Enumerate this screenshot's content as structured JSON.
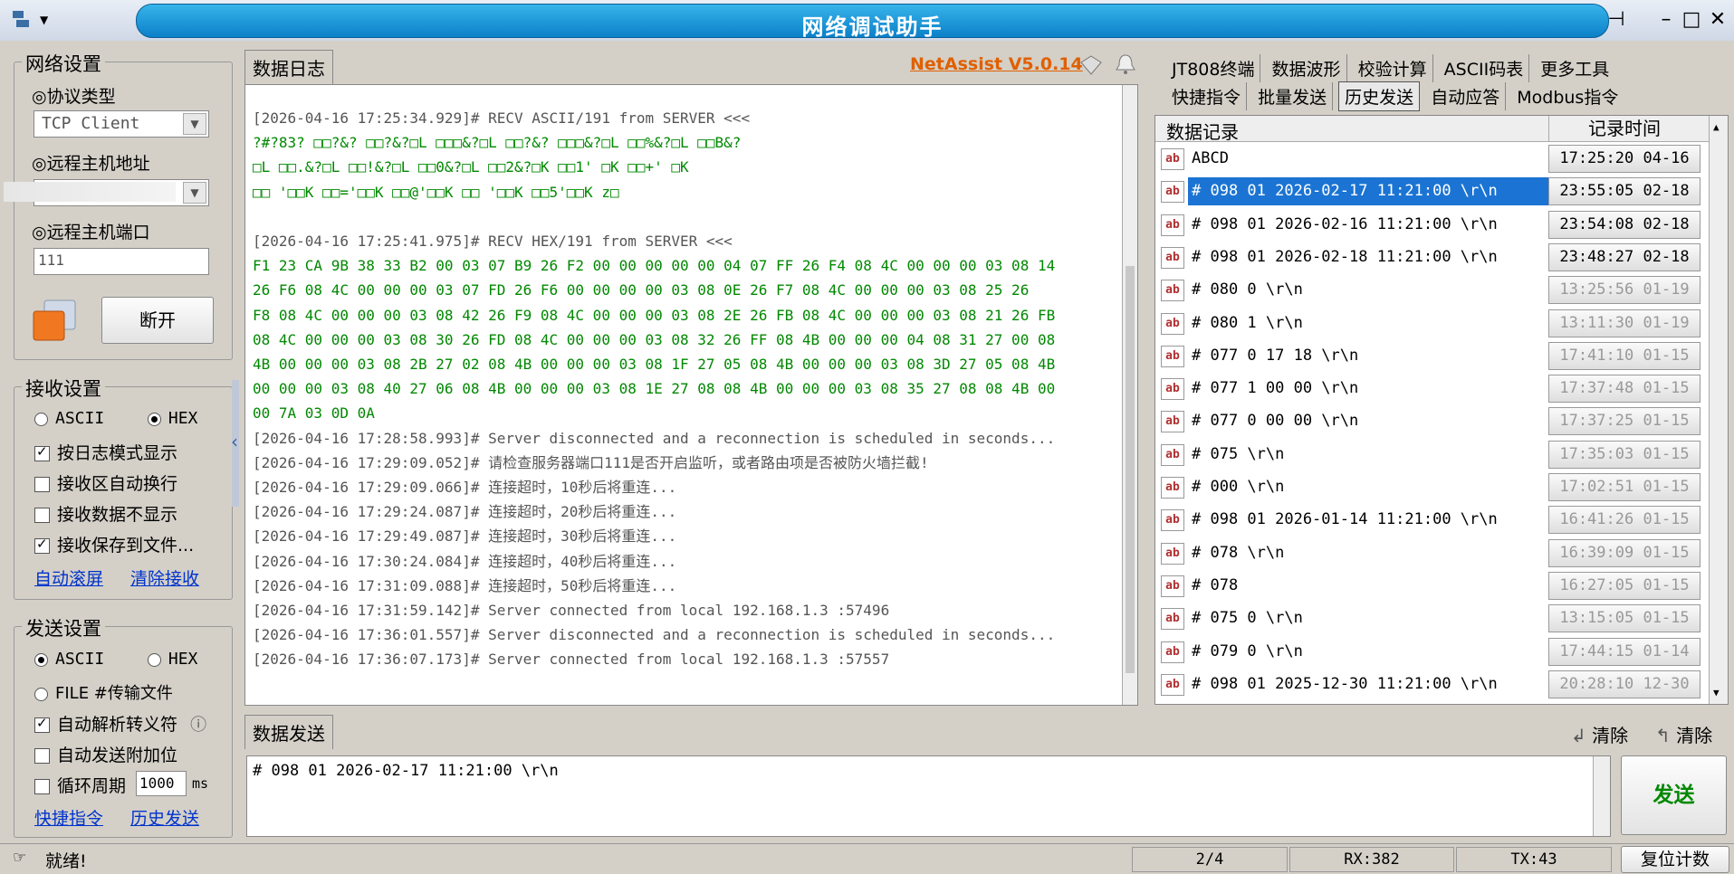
{
  "window": {
    "title": "网络调试助手"
  },
  "network_settings": {
    "title": "网络设置",
    "protocol_label": "◎协议类型",
    "protocol_value": "TCP Client",
    "host_label": "◎远程主机地址",
    "port_label": "◎远程主机端口",
    "port_value": "111",
    "disconnect_label": "断开"
  },
  "receive_settings": {
    "title": "接收设置",
    "mode_ascii": "ASCII",
    "mode_hex": "HEX",
    "mode_selected": "HEX",
    "options": [
      {
        "label": "按日志模式显示",
        "checked": true
      },
      {
        "label": "接收区自动换行",
        "checked": false
      },
      {
        "label": "接收数据不显示",
        "checked": false
      },
      {
        "label": "接收保存到文件...",
        "checked": true
      }
    ],
    "link_autoscroll": "自动滚屏",
    "link_clear": "清除接收"
  },
  "send_settings": {
    "title": "发送设置",
    "mode_ascii": "ASCII",
    "mode_hex": "HEX",
    "mode_selected": "ASCII",
    "file_label": "FILE #传输文件",
    "opt_escape": "自动解析转义符",
    "opt_escape_checked": true,
    "info_icon": "ⓘ",
    "opt_append": "自动发送附加位",
    "opt_append_checked": false,
    "opt_cycle": "循环周期",
    "opt_cycle_checked": false,
    "cycle_value": "1000",
    "cycle_unit": "ms",
    "link_shortcut": "快捷指令",
    "link_history": "历史发送"
  },
  "log_panel": {
    "tab": "数据日志",
    "brand": "NetAssist V5.0.14",
    "lines": [
      {
        "text": "[2026-04-16 17:25:34.929]# RECV ASCII/191 from SERVER <<<",
        "color": "gray"
      },
      {
        "text": "?#?83? □□?&?     □□?&?□L   □□□&?□L   □□?&?     □□□&?□L   □□%&?□L   □□B&?",
        "color": "green"
      },
      {
        "text": "□L   □□.&?□L   □□!&?□L   □□0&?□L   □□2&?□K   □□1' □K   □□+' □K",
        "color": "green"
      },
      {
        "text": "□□  '□□K   □□='□□K   □□@'□□K   □□  '□□K   □□5'□□K  z□",
        "color": "green"
      },
      {
        "text": "",
        "color": "gray"
      },
      {
        "text": "[2026-04-16 17:25:41.975]# RECV HEX/191 from SERVER <<<",
        "color": "gray"
      },
      {
        "text": "F1 23 CA 9B 38 33 B2 00 03 07 B9 26 F2 00 00 00 00 00 04 07 FF 26 F4 08 4C 00 00 00 03 08 14",
        "color": "green"
      },
      {
        "text": "26 F6 08 4C 00 00 00 03 07 FD 26 F6 00 00 00 00 03 08 0E 26 F7 08 4C 00 00 00 03 08 25 26",
        "color": "green"
      },
      {
        "text": "F8 08 4C 00 00 00 03 08 42 26 F9 08 4C 00 00 00 03 08 2E 26 FB 08 4C 00 00 00 03 08 21 26 FB",
        "color": "green"
      },
      {
        "text": "08 4C 00 00 00 03 08 30 26 FD 08 4C 00 00 00 03 08 32 26 FF 08 4B 00 00 00 04 08 31 27 00 08",
        "color": "green"
      },
      {
        "text": "4B 00 00 00 03 08 2B 27 02 08 4B 00 00 00 03 08 1F 27 05 08 4B 00 00 00 03 08 3D 27 05 08 4B",
        "color": "green"
      },
      {
        "text": "00 00 00 03 08 40 27 06 08 4B 00 00 00 03 08 1E 27 08 08 4B 00 00 00 03 08 35 27 08 08 4B 00",
        "color": "green"
      },
      {
        "text": "00 7A 03 0D 0A",
        "color": "green"
      },
      {
        "text": "[2026-04-16 17:28:58.993]# Server disconnected and a reconnection is scheduled in seconds...",
        "color": "gray"
      },
      {
        "text": "[2026-04-16 17:29:09.052]# 请检查服务器端口111是否开启监听，或者路由项是否被防火墙拦截!",
        "color": "gray"
      },
      {
        "text": "[2026-04-16 17:29:09.066]# 连接超时，10秒后将重连...",
        "color": "gray"
      },
      {
        "text": "[2026-04-16 17:29:24.087]# 连接超时，20秒后将重连...",
        "color": "gray"
      },
      {
        "text": "[2026-04-16 17:29:49.087]# 连接超时，30秒后将重连...",
        "color": "gray"
      },
      {
        "text": "[2026-04-16 17:30:24.084]# 连接超时，40秒后将重连...",
        "color": "gray"
      },
      {
        "text": "[2026-04-16 17:31:09.088]# 连接超时，50秒后将重连...",
        "color": "gray"
      },
      {
        "text": "[2026-04-16 17:31:59.142]# Server connected from local 192.168.1.3 :57496",
        "color": "gray"
      },
      {
        "text": "[2026-04-16 17:36:01.557]# Server disconnected and a reconnection is scheduled in seconds...",
        "color": "gray"
      },
      {
        "text": "[2026-04-16 17:36:07.173]# Server connected from local 192.168.1.3 :57557",
        "color": "gray"
      }
    ]
  },
  "right_tabs_row1": [
    "JT808终端",
    "数据波形",
    "校验计算",
    "ASCII码表",
    "更多工具"
  ],
  "right_tabs_row2": [
    "快捷指令",
    "批量发送",
    "历史发送",
    "自动应答",
    "Modbus指令"
  ],
  "right_tab_active": "历史发送",
  "records": {
    "col_data": "数据记录",
    "col_time": "记录时间",
    "icon": "ab",
    "rows": [
      {
        "text": "ABCD",
        "time": "17:25:20 04-16",
        "dim": false,
        "selected": false
      },
      {
        "text": "# 098 01 2026-02-17 11:21:00 \\r\\n",
        "time": "23:55:05 02-18",
        "dim": false,
        "selected": true
      },
      {
        "text": "# 098 01 2026-02-16 11:21:00 \\r\\n",
        "time": "23:54:08 02-18",
        "dim": false,
        "selected": false
      },
      {
        "text": "# 098 01 2026-02-18 11:21:00 \\r\\n",
        "time": "23:48:27 02-18",
        "dim": false,
        "selected": false
      },
      {
        "text": "# 080 0 \\r\\n",
        "time": "13:25:56 01-19",
        "dim": true,
        "selected": false
      },
      {
        "text": "# 080 1 \\r\\n",
        "time": "13:11:30 01-19",
        "dim": true,
        "selected": false
      },
      {
        "text": "# 077 0 17 18 \\r\\n",
        "time": "17:41:10 01-15",
        "dim": true,
        "selected": false
      },
      {
        "text": "# 077 1 00 00 \\r\\n",
        "time": "17:37:48 01-15",
        "dim": true,
        "selected": false
      },
      {
        "text": "# 077 0 00 00 \\r\\n",
        "time": "17:37:25 01-15",
        "dim": true,
        "selected": false
      },
      {
        "text": "# 075 \\r\\n",
        "time": "17:35:03 01-15",
        "dim": true,
        "selected": false
      },
      {
        "text": "# 000 \\r\\n",
        "time": "17:02:51 01-15",
        "dim": true,
        "selected": false
      },
      {
        "text": "# 098 01 2026-01-14 11:21:00 \\r\\n",
        "time": "16:41:26 01-15",
        "dim": true,
        "selected": false
      },
      {
        "text": "# 078 \\r\\n",
        "time": "16:39:09 01-15",
        "dim": true,
        "selected": false
      },
      {
        "text": "# 078",
        "time": "16:27:05 01-15",
        "dim": true,
        "selected": false
      },
      {
        "text": "# 075 0 \\r\\n",
        "time": "13:15:05 01-15",
        "dim": true,
        "selected": false
      },
      {
        "text": "# 079 0 \\r\\n",
        "time": "17:44:15 01-14",
        "dim": true,
        "selected": false
      },
      {
        "text": "# 098 01 2025-12-30 11:21:00 \\r\\n",
        "time": "20:28:10 12-30",
        "dim": true,
        "selected": false
      }
    ]
  },
  "send_panel": {
    "tab": "数据发送",
    "clear1": "清除",
    "clear2": "清除",
    "input_value": "# 098 01 2026-02-17 11:21:00 \\r\\n",
    "send_label": "发送"
  },
  "status": {
    "ready": "就绪!",
    "page": "2/4",
    "rx": "RX:382",
    "tx": "TX:43",
    "reset": "复位计数"
  }
}
